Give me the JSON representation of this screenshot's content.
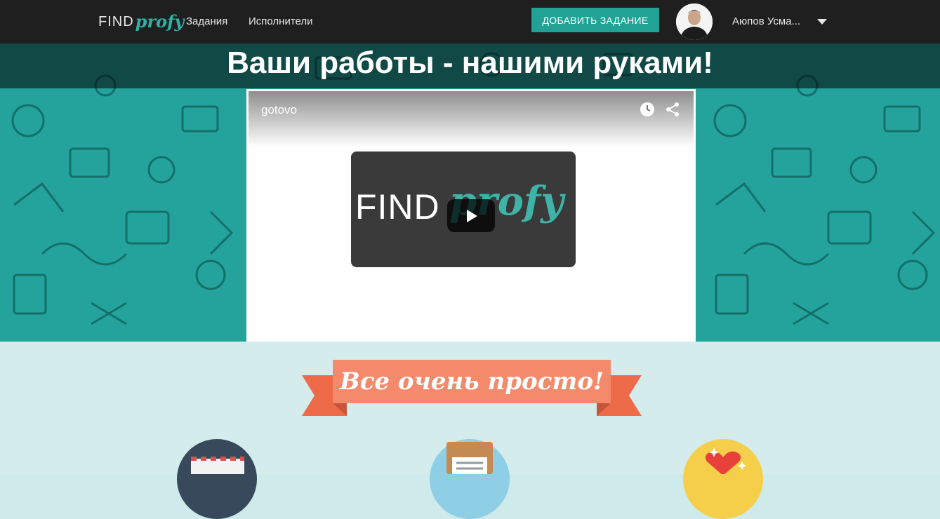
{
  "nav": {
    "logo_part1": "FIND",
    "logo_part2": "profy",
    "links": [
      "Задания",
      "Исполнители"
    ],
    "add_task": "ДОБАВИТЬ ЗАДАНИЕ",
    "user_name": "Аюпов Усма..."
  },
  "hero": {
    "title": "Ваши работы - нашими руками!"
  },
  "video": {
    "title": "gotovo",
    "thumb_part1": "FIND",
    "thumb_part2": "profy"
  },
  "section": {
    "ribbon": "Все очень просто!"
  },
  "colors": {
    "accent": "#21a295",
    "ribbon": "#f38a6c",
    "hero_bg": "#24a39c"
  }
}
